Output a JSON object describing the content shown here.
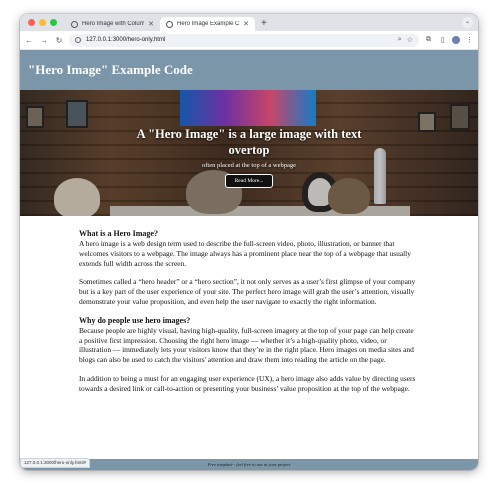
{
  "browser": {
    "tabs": [
      {
        "title": "Hero Image with Columns",
        "active": false
      },
      {
        "title": "Hero Image Example Code",
        "active": true
      }
    ],
    "new_tab": "+",
    "url": "127.0.0.1:3000/hero-only.html",
    "status_url": "127.0.0.1:3000/hero-only.html#"
  },
  "site": {
    "title": "\"Hero Image\" Example Code"
  },
  "hero": {
    "heading": "A \"Hero Image\" is a large image with text overtop",
    "subheading": "often placed at the top of a webpage",
    "button_label": "Read More..."
  },
  "content": [
    {
      "heading": "What is a Hero Image?",
      "text": "A hero image is a web design term used to describe the full-screen video, photo, illustration, or banner that welcomes visitors to a webpage. The image always has a prominent place near the top of a webpage that usually extends full width across the screen."
    },
    {
      "text": "Sometimes called a “hero header” or a “hero section”, it not only serves as a user’s first glimpse of your company but is a key part of the user experience of your site. The perfect hero image will grab the user’s attention, visually demonstrate your value proposition, and even help the user navigate to exactly the right information."
    },
    {
      "heading": "Why do people use hero images?",
      "text": "Because people are highly visual, having high-quality, full-screen imagery at the top of your page can help create a positive first impression. Choosing the right hero image — whether it’s a high-quality photo, video, or illustration — immediately lets your visitors know that they’re in the right place. Hero images on media sites and blogs can also be used to catch the visitors' attention and draw them into reading the article on the page."
    },
    {
      "text": "In addition to being a must for an engaging user experience (UX), a hero image also adds value by directing users towards a desired link or call-to-action or presenting your business’ value proposition at the top of the webpage."
    }
  ],
  "footer": {
    "text": "Free template - feel free to use in your project"
  }
}
